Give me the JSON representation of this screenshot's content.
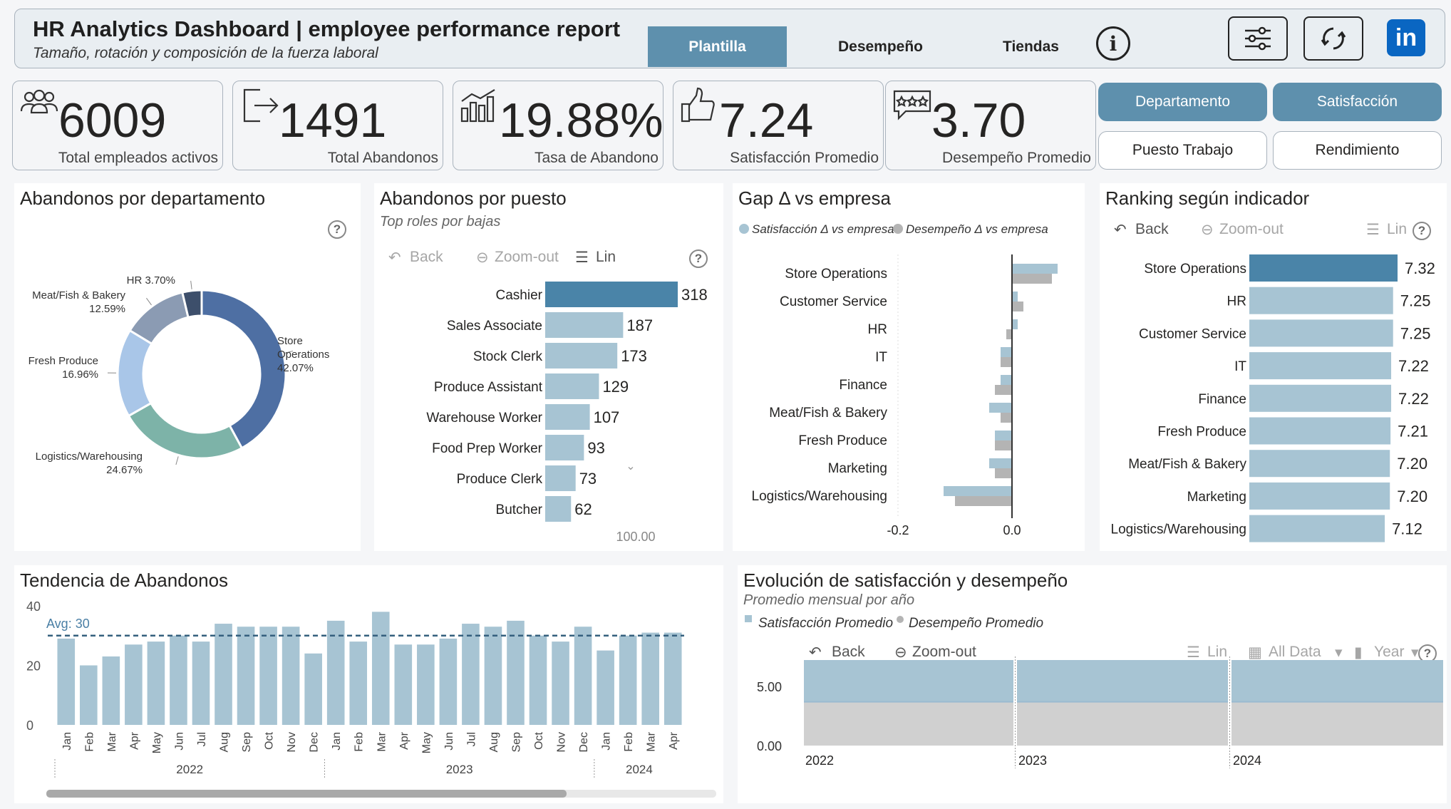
{
  "header": {
    "title": "HR Analytics Dashboard | employee performance report",
    "subtitle": "Tamaño, rotación y composición de la fuerza laboral",
    "tabs": [
      {
        "label": "Plantilla",
        "active": true
      },
      {
        "label": "Desempeño",
        "active": false
      },
      {
        "label": "Tiendas",
        "active": false
      }
    ],
    "info_icon": "info-icon",
    "filter_icon": "sliders-icon",
    "refresh_icon": "refresh-icon",
    "linkedin_label": "in"
  },
  "kpis": [
    {
      "value": "6009",
      "label": "Total empleados activos",
      "icon": "people-icon"
    },
    {
      "value": "1491",
      "label": "Total Abandonos",
      "icon": "exit-icon"
    },
    {
      "value": "19.88%",
      "label": "Tasa de Abandono",
      "icon": "bar-chart-icon"
    },
    {
      "value": "7.24",
      "label": "Satisfacción Promedio",
      "icon": "thumbs-up-icon"
    },
    {
      "value": "3.70",
      "label": "Desempeño Promedio",
      "icon": "rating-stars-icon"
    }
  ],
  "filter_buttons": [
    {
      "label": "Departamento",
      "selected": true
    },
    {
      "label": "Satisfacción",
      "selected": true
    },
    {
      "label": "Puesto Trabajo",
      "selected": false
    },
    {
      "label": "Rendimiento",
      "selected": false
    }
  ],
  "colors": {
    "accent": "#5e90ad",
    "bar_light": "#a7c4d3",
    "bar_dark": "#4a84a8",
    "gray_series": "#b4b4b4"
  },
  "toolbar": {
    "back": "Back",
    "zoom_out": "Zoom-out",
    "lin": "Lin",
    "all_data": "All Data",
    "year": "Year"
  },
  "panels": {
    "dept": {
      "title": "Abandonos por departamento"
    },
    "puesto": {
      "title": "Abandonos por puesto",
      "subtitle": "Top roles por bajas",
      "axis_value": "100.00"
    },
    "gap": {
      "title": "Gap Δ vs empresa"
    },
    "ranking": {
      "title": "Ranking según indicador"
    },
    "trend": {
      "title": "Tendencia de Abandonos"
    },
    "evol": {
      "title": "Evolución de satisfacción y desempeño",
      "subtitle": "Promedio mensual por año"
    }
  },
  "chart_data": [
    {
      "type": "pie",
      "id": "donut-departamento",
      "labels": [
        "Store Operations",
        "Logistics/Warehousing",
        "Fresh Produce",
        "Meat/Fish & Bakery",
        "HR"
      ],
      "values": [
        42.07,
        24.67,
        16.96,
        12.59,
        3.7
      ],
      "display": [
        [
          "Store",
          "Operations",
          "42.07%"
        ],
        [
          "Logistics/Warehousing",
          "24.67%"
        ],
        [
          "Fresh Produce",
          "16.96%"
        ],
        [
          "Meat/Fish & Bakery",
          "12.59%"
        ],
        [
          "HR 3.70%"
        ]
      ],
      "colors": [
        "#4e6fa3",
        "#7db3a8",
        "#a9c6e8",
        "#8b9bb3",
        "#3d4f6b"
      ]
    },
    {
      "type": "bar",
      "id": "abandonos-puesto",
      "categories": [
        "Cashier",
        "Sales Associate",
        "Stock Clerk",
        "Produce Assistant",
        "Warehouse Worker",
        "Food Prep Worker",
        "Produce Clerk",
        "Butcher"
      ],
      "values": [
        318,
        187,
        173,
        129,
        107,
        93,
        73,
        62
      ]
    },
    {
      "type": "bar",
      "id": "gap-vs-empresa",
      "categories": [
        "Store Operations",
        "Customer Service",
        "HR",
        "IT",
        "Finance",
        "Meat/Fish & Bakery",
        "Fresh Produce",
        "Marketing",
        "Logistics/Warehousing"
      ],
      "series": [
        {
          "name": "Satisfacción Δ vs empresa",
          "values": [
            0.08,
            0.01,
            0.01,
            -0.02,
            -0.02,
            -0.04,
            -0.03,
            -0.04,
            -0.12
          ]
        },
        {
          "name": "Desempeño Δ vs empresa",
          "values": [
            0.07,
            0.02,
            -0.01,
            -0.02,
            -0.03,
            -0.02,
            -0.03,
            -0.03,
            -0.1
          ]
        }
      ],
      "x_ticks": [
        "-0.2",
        "0.0"
      ],
      "xlim": [
        -0.2,
        0.08
      ]
    },
    {
      "type": "bar",
      "id": "ranking-indicador",
      "categories": [
        "Store Operations",
        "HR",
        "Customer Service",
        "IT",
        "Finance",
        "Fresh Produce",
        "Meat/Fish & Bakery",
        "Marketing",
        "Logistics/Warehousing"
      ],
      "values": [
        7.32,
        7.25,
        7.25,
        7.22,
        7.22,
        7.21,
        7.2,
        7.2,
        7.12
      ]
    },
    {
      "type": "bar",
      "id": "tendencia-abandonos",
      "months": [
        "Jan",
        "Feb",
        "Mar",
        "Apr",
        "May",
        "Jun",
        "Jul",
        "Aug",
        "Sep",
        "Oct",
        "Nov",
        "Dec",
        "Jan",
        "Feb",
        "Mar",
        "Apr",
        "May",
        "Jun",
        "Jul",
        "Aug",
        "Sep",
        "Oct",
        "Nov",
        "Dec",
        "Jan",
        "Feb",
        "Mar",
        "Apr"
      ],
      "years": [
        {
          "label": "2022",
          "count": 12
        },
        {
          "label": "2023",
          "count": 12
        },
        {
          "label": "2024",
          "count": 4
        }
      ],
      "values": [
        29,
        20,
        23,
        27,
        28,
        30,
        28,
        34,
        33,
        33,
        33,
        24,
        35,
        28,
        38,
        27,
        27,
        29,
        34,
        33,
        35,
        30,
        28,
        33,
        25,
        30,
        31,
        31
      ],
      "avg_label": "Avg: 30",
      "avg": 30,
      "y_ticks": [
        "0",
        "20",
        "40"
      ],
      "ylim": [
        0,
        40
      ]
    },
    {
      "type": "area",
      "id": "evolucion-satisfaccion",
      "x": [
        "2022",
        "2023",
        "2024"
      ],
      "series": [
        {
          "name": "Satisfacción Promedio",
          "values": [
            7.24,
            7.24,
            7.24
          ]
        },
        {
          "name": "Desempeño Promedio",
          "values": [
            3.7,
            3.7,
            3.7
          ]
        }
      ],
      "y_ticks": [
        "0.00",
        "5.00"
      ],
      "ylim": [
        0,
        7.24
      ]
    }
  ]
}
